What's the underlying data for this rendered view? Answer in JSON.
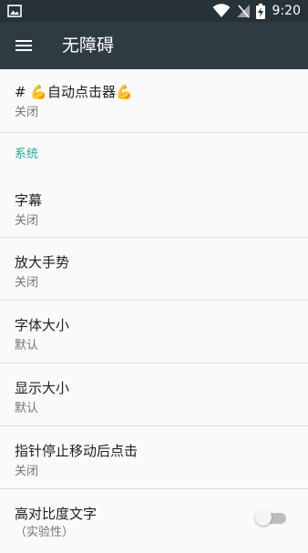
{
  "status_bar": {
    "time": "9:20"
  },
  "app_bar": {
    "title": "无障碍"
  },
  "items": [
    {
      "title": "# 💪自动点击器💪",
      "summary": "关闭"
    }
  ],
  "section": {
    "label": "系统"
  },
  "system_items": [
    {
      "title": "字幕",
      "summary": "关闭"
    },
    {
      "title": "放大手势",
      "summary": "关闭"
    },
    {
      "title": "字体大小",
      "summary": "默认"
    },
    {
      "title": "显示大小",
      "summary": "默认"
    },
    {
      "title": "指针停止移动后点击",
      "summary": "关闭"
    },
    {
      "title": "高对比度文字",
      "summary": "（实验性）",
      "toggle": "off"
    }
  ]
}
